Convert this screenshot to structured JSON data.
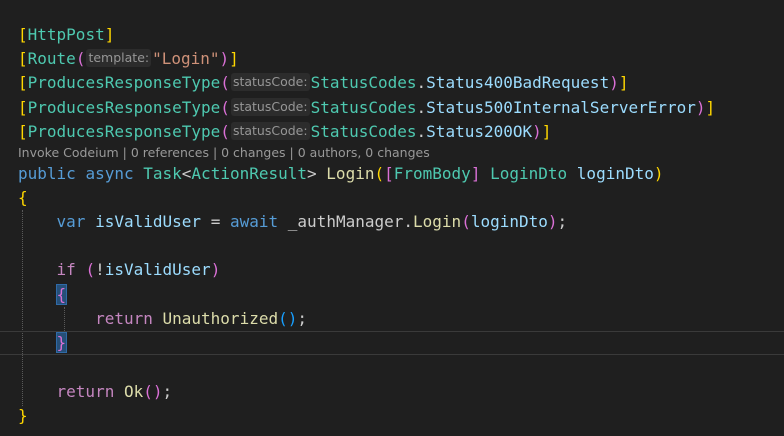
{
  "code": {
    "attr_httppost": "HttpPost",
    "attr_route": "Route",
    "route_hint": "template:",
    "route_value": "\"Login\"",
    "attr_produces": "ProducesResponseType",
    "status_hint": "statusCode:",
    "status_class": "StatusCodes",
    "status_400": "Status400BadRequest",
    "status_500": "Status500InternalServerError",
    "status_200": "Status200OK",
    "codelens": "Invoke Codeium | 0 references | 0 changes | 0 authors, 0 changes",
    "kw_public": "public",
    "kw_async": "async",
    "type_task": "Task",
    "type_actionresult": "ActionResult",
    "method_login": "Login",
    "attr_frombody": "FromBody",
    "type_logindto": "LoginDto",
    "param_logindto": "loginDto",
    "kw_var": "var",
    "var_isvalid": "isValidUser",
    "kw_await": "await",
    "field_authmanager": "_authManager",
    "kw_if": "if",
    "kw_return": "return",
    "method_unauthorized": "Unauthorized",
    "method_ok": "Ok"
  },
  "colors": {
    "background": "#1f1f1f",
    "type": "#4ec9b0",
    "keyword": "#569cd6",
    "control": "#c586c0",
    "string": "#ce9178",
    "method": "#dcdcaa",
    "variable": "#9cdcfe",
    "bracket_1": "#ffd700",
    "bracket_2": "#da70d6",
    "bracket_3": "#179fff"
  }
}
